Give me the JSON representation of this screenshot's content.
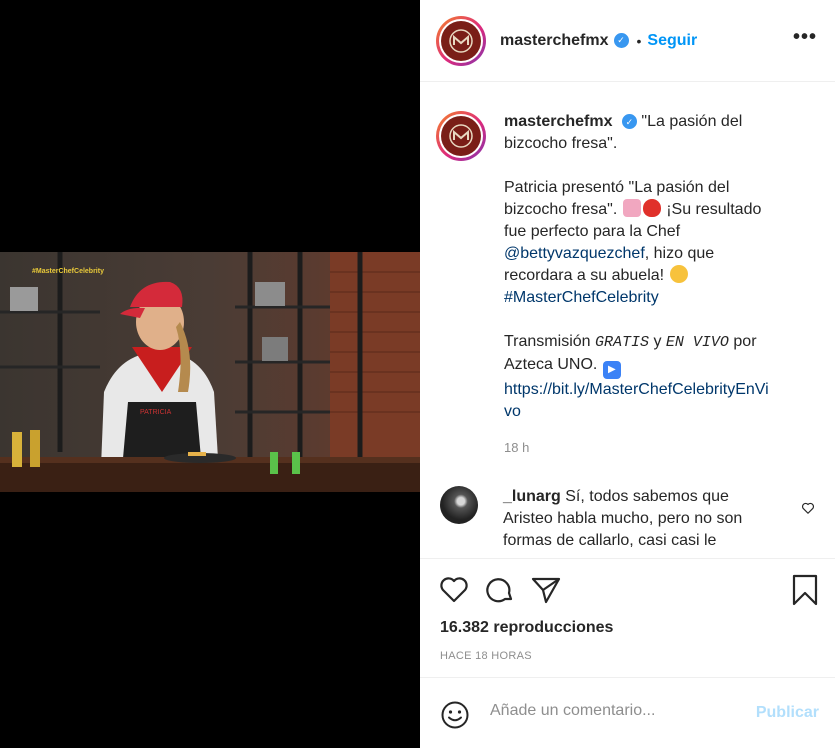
{
  "video": {
    "tag": "#MasterChefCelebrity"
  },
  "header": {
    "username": "masterchefmx",
    "separator": "•",
    "follow_label": "Seguir",
    "more_label": "..."
  },
  "caption": {
    "username": "masterchefmx",
    "title": "\"La pasión del bizcocho fresa\".",
    "p2_a": "Patricia presentó \"La pasión del bizcocho fresa\".",
    "p2_b": "¡Su resultado fue perfecto para la Chef",
    "mention": "@bettyvazquezchef",
    "p2_c": ", hizo que recordara a su abuela!",
    "hashtag": "#MasterChefCelebrity",
    "p3_a": "Transmisión",
    "p3_gratis": "GRATIS",
    "p3_y": "y",
    "p3_envivo": "EN VIVO",
    "p3_b": "por Azteca UNO.",
    "url": "https://bit.ly/MasterChefCelebrityEnVivo",
    "time": "18 h"
  },
  "comment": {
    "username": "_lunarg",
    "text": "Sí, todos sabemos que Aristeo habla mucho, pero no son formas de callarlo, casi casi le"
  },
  "stats": {
    "views": "16.382 reproducciones",
    "ago": "HACE 18 HORAS"
  },
  "add_comment": {
    "placeholder": "Añade un comentario...",
    "publish_label": "Publicar"
  },
  "icons": [
    "verified-icon",
    "more-icon",
    "heart-icon",
    "comment-icon",
    "share-icon",
    "bookmark-icon",
    "smile-icon",
    "cupcake-emoji",
    "strawberry-emoji",
    "smiling-face-emoji",
    "play-button-emoji"
  ],
  "colors": {
    "accent": "#0095f6",
    "verified": "#3897f0",
    "link": "#00376b",
    "muted": "#8e8e8e",
    "publish_disabled": "#b2dffc"
  }
}
